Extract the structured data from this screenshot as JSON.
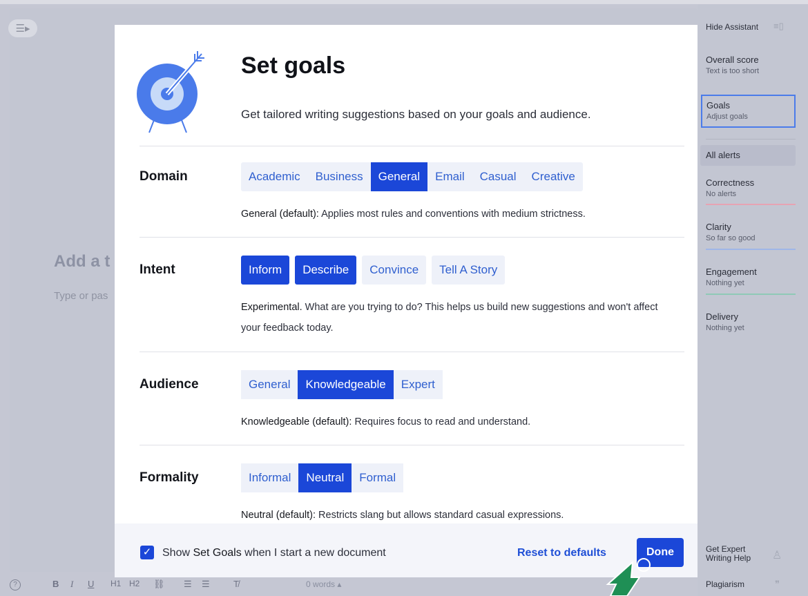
{
  "editor": {
    "title_placeholder": "Add a t",
    "body_placeholder": "Type or pas",
    "word_count": "0 words",
    "toolbar": [
      "B",
      "I",
      "U",
      "H1",
      "H2"
    ]
  },
  "sidebar": {
    "hide_label": "Hide Assistant",
    "overall_score": {
      "title": "Overall score",
      "sub": "Text is too short"
    },
    "goals": {
      "title": "Goals",
      "sub": "Adjust goals"
    },
    "all_alerts": "All alerts",
    "categories": [
      {
        "title": "Correctness",
        "sub": "No alerts",
        "color": "#e7a3b3"
      },
      {
        "title": "Clarity",
        "sub": "So far so good",
        "color": "#9fb6e8"
      },
      {
        "title": "Engagement",
        "sub": "Nothing yet",
        "color": "#8fc9b6"
      },
      {
        "title": "Delivery",
        "sub": "Nothing yet",
        "color": "#b9a6e0"
      }
    ],
    "expert_line1": "Get Expert",
    "expert_line2": "Writing Help",
    "plagiarism": "Plagiarism"
  },
  "modal": {
    "title": "Set goals",
    "subtitle": "Get tailored writing suggestions based on your goals and audience.",
    "domain": {
      "label": "Domain",
      "options": [
        "Academic",
        "Business",
        "General",
        "Email",
        "Casual",
        "Creative"
      ],
      "selected": "General",
      "desc_bold": "General (default):",
      "desc": " Applies most rules and conventions with medium strictness."
    },
    "intent": {
      "label": "Intent",
      "options": [
        "Inform",
        "Describe",
        "Convince",
        "Tell A Story"
      ],
      "selected": [
        "Inform",
        "Describe"
      ],
      "desc_bold": "Experimental.",
      "desc": " What are you trying to do? This helps us build new suggestions and won't affect your feedback today."
    },
    "audience": {
      "label": "Audience",
      "options": [
        "General",
        "Knowledgeable",
        "Expert"
      ],
      "selected": "Knowledgeable",
      "desc_bold": "Knowledgeable (default):",
      "desc": " Requires focus to read and understand."
    },
    "formality": {
      "label": "Formality",
      "options": [
        "Informal",
        "Neutral",
        "Formal"
      ],
      "selected": "Neutral",
      "desc_bold": "Neutral (default):",
      "desc": " Restricts slang but allows standard casual expressions."
    },
    "footer": {
      "checkbox_checked": true,
      "checkbox_pre": "Show ",
      "checkbox_bold": "Set Goals",
      "checkbox_post": " when I start a new document",
      "reset": "Reset to defaults",
      "done": "Done"
    }
  },
  "colors": {
    "accent": "#1b47d8",
    "option_bg": "#eef1f9",
    "option_text": "#2f5fcf",
    "target_outer": "#4a7bea",
    "target_inner": "#c7daf8"
  }
}
